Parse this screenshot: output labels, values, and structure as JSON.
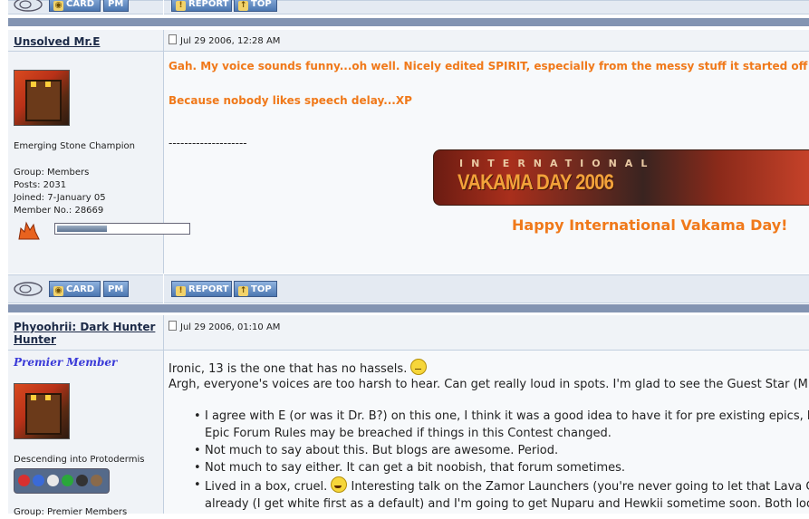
{
  "buttons": {
    "card": "CARD",
    "pm": "PM",
    "report": "REPORT",
    "top": "TOP"
  },
  "post1": {
    "username": "Unsolved Mr.E",
    "date": "Jul 29 2006, 12:28 AM",
    "title": "Emerging Stone Champion",
    "group": "Group: Members",
    "posts": "Posts: 2031",
    "joined": "Joined: 7-January 05",
    "member_no": "Member No.: 28669",
    "reputation_fraction": 0.38,
    "line1": "Gah. My voice sounds funny...oh well. Nicely edited SPIRIT, especially from the messy stuff it started off wi",
    "line2": "Because nobody likes speech delay...XP",
    "separator": "--------------------",
    "banner_top": "INTERNATIONAL",
    "banner_main": "VAKAMA DAY 2006",
    "sig_text": "Happy International Vakama Day!"
  },
  "post2": {
    "username": "Phyoohrii: Dark Hunter Hunter",
    "date": "Jul 29 2006, 01:10 AM",
    "rank": "Premier Member",
    "title": "Descending into Protodermis",
    "group_partial": "Group: Premier Members",
    "line1": "Ironic, 13 is the one that has no hassels.",
    "line2": "Argh, everyone's voices are too harsh to hear. Can get really loud in spots. I'm glad to see the Guest Star (Mr. E",
    "bullets": [
      "I agree with E (or was it Dr. B?) on this one, I think it was a good idea to have it for pre existing epics, be",
      "Epic Forum Rules may be breached if things in this Contest changed.",
      "Not much to say about this. But blogs are awesome. Period.",
      "Not much to say either. It can get a bit noobish, that forum sometimes.",
      "Lived in a box, cruel.",
      "Interesting talk on the Zamor Launchers (you're never going to let that Lava Cha",
      "already (I get white first as a default) and I'm going to get Nuparu and Hewkii sometime soon. Both look r"
    ]
  },
  "colors": {
    "accent_orange": "#f0791a",
    "bar_blue": "#8394b2",
    "button_blue": "#4c77b1"
  }
}
